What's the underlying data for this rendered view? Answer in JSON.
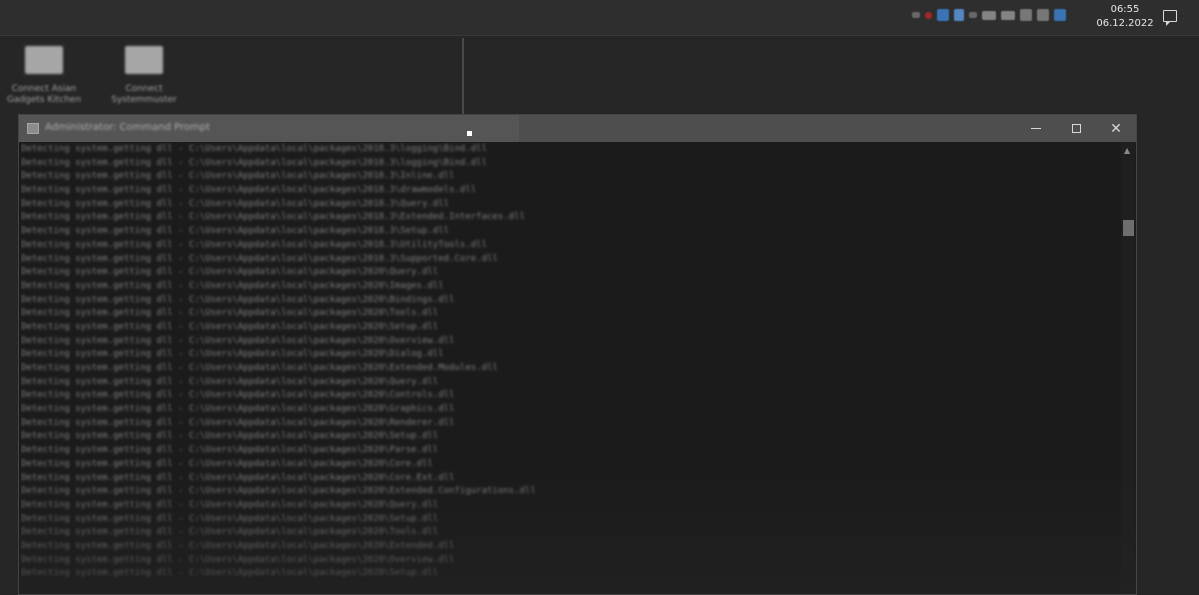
{
  "taskbar": {
    "clock": {
      "time": "06:55",
      "date": "06.12.2022"
    },
    "tray_icons": [
      "chevron-up-icon",
      "antivirus-icon",
      "app-icon",
      "network-app-icon",
      "battery-icon",
      "keyboard-icon",
      "network-icon",
      "speaker-icon"
    ]
  },
  "desktop": {
    "icons": [
      {
        "label": "Connect Asian\nGadgets Kitchen"
      },
      {
        "label": "Connect\nSystemmuster"
      }
    ]
  },
  "console": {
    "title": "Administrator: Command Prompt",
    "controls": {
      "minimize": "—",
      "maximize": "☐",
      "close": "✕"
    },
    "lines": [
      "Detecting system.getting dll  -  C:\\Users\\Appdata\\local\\packages\\2018.3\\logging\\Bind.dll",
      "Detecting system.getting dll  -  C:\\Users\\Appdata\\local\\packages\\2018.3\\logging\\Bind.dll",
      "Detecting system.getting dll  -  C:\\Users\\Appdata\\local\\packages\\2018.3\\Inline.dll",
      "Detecting system.getting dll  -  C:\\Users\\Appdata\\local\\packages\\2018.3\\drawmodels.dll",
      "Detecting system.getting dll  -  C:\\Users\\Appdata\\local\\packages\\2018.3\\Query.dll",
      "Detecting system.getting dll  -  C:\\Users\\Appdata\\local\\packages\\2018.3\\Extended.Interfaces.dll",
      "Detecting system.getting dll  -  C:\\Users\\Appdata\\local\\packages\\2018.3\\Setup.dll",
      "Detecting system.getting dll  -  C:\\Users\\Appdata\\local\\packages\\2018.3\\UtilityTools.dll",
      "Detecting system.getting dll  -  C:\\Users\\Appdata\\local\\packages\\2018.3\\Supported.Core.dll",
      "Detecting system.getting dll  -  C:\\Users\\Appdata\\local\\packages\\2020\\Query.dll",
      "Detecting system.getting dll  -  C:\\Users\\Appdata\\local\\packages\\2020\\Images.dll",
      "Detecting system.getting dll  -  C:\\Users\\Appdata\\local\\packages\\2020\\Bindings.dll",
      "Detecting system.getting dll  -  C:\\Users\\Appdata\\local\\packages\\2020\\Tools.dll",
      "Detecting system.getting dll  -  C:\\Users\\Appdata\\local\\packages\\2020\\Setup.dll",
      "Detecting system.getting dll  -  C:\\Users\\Appdata\\local\\packages\\2020\\Overview.dll",
      "Detecting system.getting dll  -  C:\\Users\\Appdata\\local\\packages\\2020\\Dialog.dll",
      "Detecting system.getting dll  -  C:\\Users\\Appdata\\local\\packages\\2020\\Extended.Modules.dll",
      "Detecting system.getting dll  -  C:\\Users\\Appdata\\local\\packages\\2020\\Query.dll",
      "Detecting system.getting dll  -  C:\\Users\\Appdata\\local\\packages\\2020\\Controls.dll",
      "Detecting system.getting dll  -  C:\\Users\\Appdata\\local\\packages\\2020\\Graphics.dll",
      "Detecting system.getting dll  -  C:\\Users\\Appdata\\local\\packages\\2020\\Renderer.dll",
      "Detecting system.getting dll  -  C:\\Users\\Appdata\\local\\packages\\2020\\Setup.dll",
      "Detecting system.getting dll  -  C:\\Users\\Appdata\\local\\packages\\2020\\Parse.dll",
      "Detecting system.getting dll  -  C:\\Users\\Appdata\\local\\packages\\2020\\Core.dll",
      "Detecting system.getting dll  -  C:\\Users\\Appdata\\local\\packages\\2020\\Core.Ext.dll",
      "Detecting system.getting dll  -  C:\\Users\\Appdata\\local\\packages\\2020\\Extended.Configurations.dll",
      "Detecting system.getting dll  -  C:\\Users\\Appdata\\local\\packages\\2020\\Query.dll",
      "Detecting system.getting dll  -  C:\\Users\\Appdata\\local\\packages\\2020\\Setup.dll",
      "Detecting system.getting dll  -  C:\\Users\\Appdata\\local\\packages\\2020\\Tools.dll",
      "Detecting system.getting dll  -  C:\\Users\\Appdata\\local\\packages\\2020\\Extended.dll",
      "Detecting system.getting dll  -  C:\\Users\\Appdata\\local\\packages\\2020\\Overview.dll",
      "Detecting system.getting dll  -  C:\\Users\\Appdata\\local\\packages\\2020\\Setup.dll"
    ]
  },
  "colors": {
    "taskbar": "#2e2e2e",
    "console_bg": "#1b1b1b",
    "titlebar": "#4e4e4e",
    "antivirus_red": "#c22525",
    "tray_blue": "#3d86d6"
  }
}
